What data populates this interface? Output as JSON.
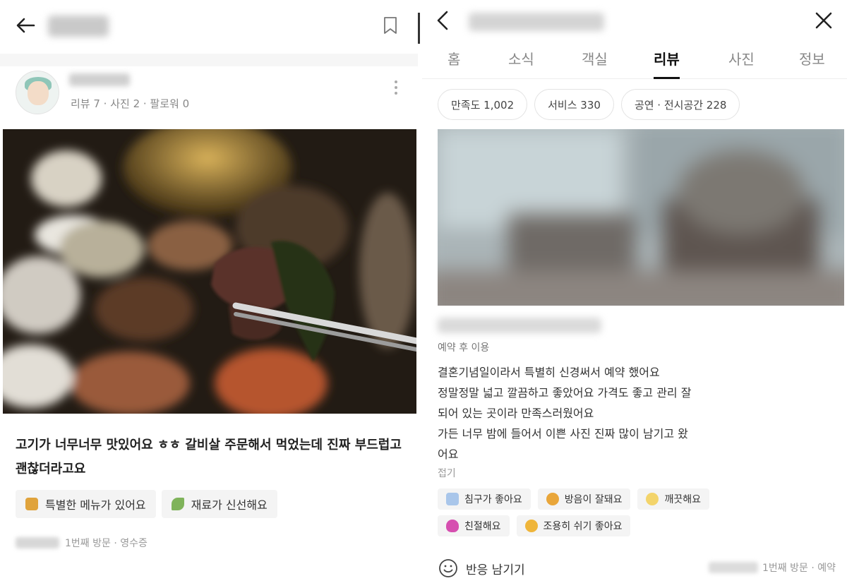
{
  "left_panel": {
    "header": {
      "back_icon": "arrow-left-icon",
      "bookmark_icon": "bookmark-icon"
    },
    "profile": {
      "meta_text": "리뷰 7 · 사진 2 · 팔로워 0",
      "more_icon": "more-vertical-icon"
    },
    "review": {
      "text": "고기가 너무너무 맛있어요 ㅎㅎ 갈비살 주문해서 먹었는데 진짜 부드럽고 괜찮더라고요",
      "keywords": [
        {
          "icon": "special-menu-icon",
          "label": "특별한 메뉴가 있어요"
        },
        {
          "icon": "fresh-ingredient-icon",
          "label": "재료가 신선해요"
        }
      ],
      "visit_info": "1번째 방문 · 영수증"
    }
  },
  "right_panel": {
    "header": {
      "back_icon": "chevron-left-icon",
      "close_icon": "close-icon"
    },
    "tabs": [
      {
        "label": "홈",
        "active": false
      },
      {
        "label": "소식",
        "active": false
      },
      {
        "label": "객실",
        "active": false
      },
      {
        "label": "리뷰",
        "active": true
      },
      {
        "label": "사진",
        "active": false
      },
      {
        "label": "정보",
        "active": false
      }
    ],
    "filter_chips": [
      {
        "label": "만족도 1,002"
      },
      {
        "label": "서비스 330"
      },
      {
        "label": "공연 · 전시공간 228"
      }
    ],
    "review": {
      "visit_type": "예약 후 이용",
      "lines": [
        "결혼기념일이라서 특별히 신경써서 예약 했어요",
        "정말정말 넓고 깔끔하고 좋았어요 가격도 좋고 관리 잘",
        "되어 있는 곳이라 만족스러웠어요",
        "가든 너무 밤에 들어서 이쁜 사진 진짜 많이 남기고 왔",
        "어요"
      ],
      "fold_label": "접기",
      "tags_row1": [
        {
          "icon": "bed-icon",
          "label": "침구가 좋아요"
        },
        {
          "icon": "soundproof-icon",
          "label": "방음이 잘돼요"
        },
        {
          "icon": "sparkle-icon",
          "label": "깨끗해요"
        }
      ],
      "tags_row2": [
        {
          "icon": "heart-icon",
          "label": "친절해요"
        },
        {
          "icon": "relax-icon",
          "label": "조용히 쉬기 좋아요"
        }
      ],
      "react_label": "반응 남기기",
      "visit_info": "1번째 방문 · 예약"
    }
  }
}
